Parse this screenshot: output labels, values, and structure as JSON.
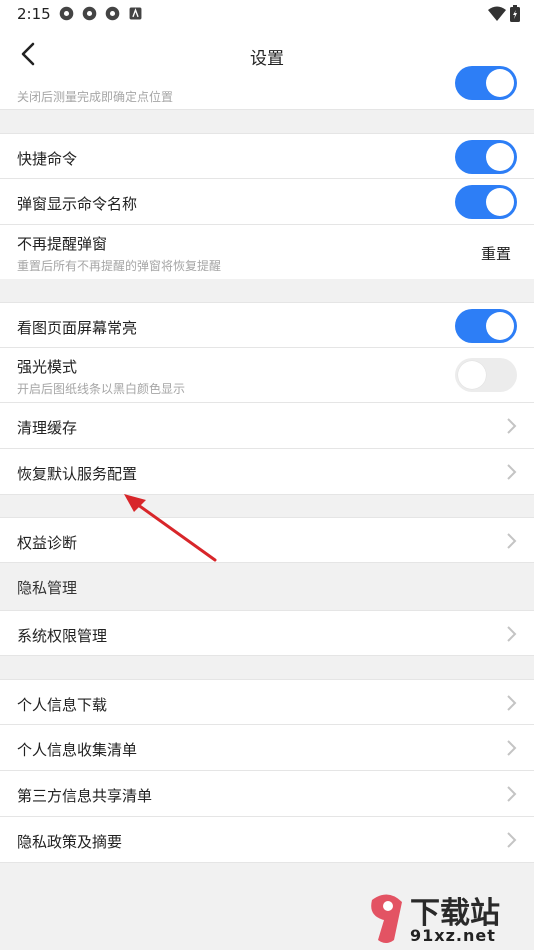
{
  "status": {
    "time": "2:15"
  },
  "header": {
    "title": "设置"
  },
  "rows": {
    "partial_subtitle": "关闭后测量完成即确定点位置",
    "quick_command": "快捷命令",
    "popup_command_name": "弹窗显示命令名称",
    "no_remind": {
      "title": "不再提醒弹窗",
      "subtitle": "重置后所有不再提醒的弹窗将恢复提醒",
      "action": "重置"
    },
    "screen_on": "看图页面屏幕常亮",
    "strong_light": {
      "title": "强光模式",
      "subtitle": "开启后图纸线条以黑白颜色显示"
    },
    "clear_cache": "清理缓存",
    "restore_default": "恢复默认服务配置",
    "rights_diagnosis": "权益诊断",
    "privacy_section": "隐私管理",
    "system_permission": "系统权限管理",
    "personal_download": "个人信息下载",
    "personal_collect": "个人信息收集清单",
    "third_party_share": "第三方信息共享清单",
    "privacy_policy": "隐私政策及摘要"
  },
  "toggles": {
    "partial": true,
    "quick_command": true,
    "popup_command_name": true,
    "screen_on": true,
    "strong_light": false
  },
  "colors": {
    "accent": "#2d7ef6",
    "annotation_arrow": "#d8262a"
  },
  "watermark": {
    "brand": "下载站",
    "domain": "91xz.net"
  }
}
